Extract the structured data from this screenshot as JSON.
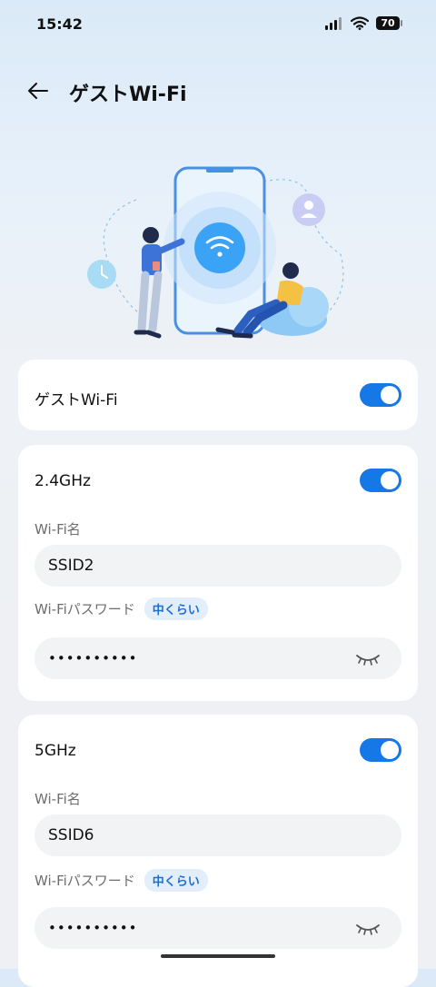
{
  "status_bar": {
    "time": "15:42",
    "battery": "70"
  },
  "header": {
    "title": "ゲストWi-Fi"
  },
  "guest_card": {
    "label": "ゲストWi-Fi",
    "enabled": true
  },
  "band_24": {
    "label": "2.4GHz",
    "enabled": true,
    "name_label": "Wi-Fi名",
    "ssid": "SSID2",
    "password_label": "Wi-Fiパスワード",
    "strength": "中くらい",
    "password_masked": "••••••••••"
  },
  "band_5": {
    "label": "5GHz",
    "enabled": true,
    "name_label": "Wi-Fi名",
    "ssid": "SSID6",
    "password_label": "Wi-Fiパスワード",
    "strength": "中くらい",
    "password_masked": "••••••••••"
  },
  "colors": {
    "accent": "#1677e6",
    "badge_bg": "#e3eefb",
    "field_bg": "#f2f3f5"
  }
}
